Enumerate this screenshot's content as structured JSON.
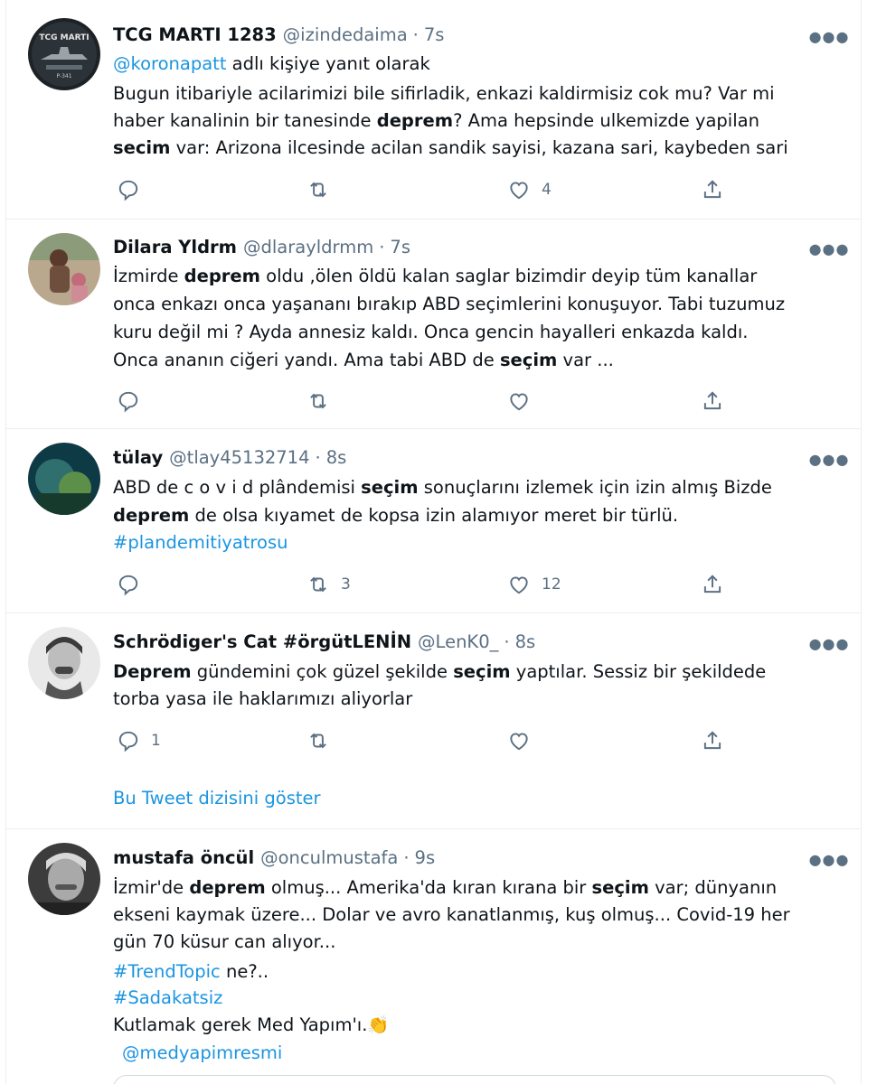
{
  "tweets": [
    {
      "name": "TCG MARTI 1283",
      "handle": "@izindedaima",
      "dot": "·",
      "time": "7s",
      "reply_to_handle": "@koronapatt",
      "reply_to_text": " adlı kişiye yanıt olarak",
      "lines": [
        [
          "Bugun itibariyle acilarimizi bile sifirladik, enkazi kaldirmisiz cok mu? Var mi"
        ],
        [
          "haber kanalinin bir tanesinde ",
          "deprem",
          "? Ama hepsinde ulkemizde yapilan"
        ],
        [
          "secim",
          " var: Arizona ilcesinde acilan sandik sayisi, kazana sari, kaybeden sari"
        ]
      ],
      "reply_count": "",
      "retweet_count": "",
      "like_count": "4",
      "avatar_text": "TCG MARTI"
    },
    {
      "name": "Dilara Yldrm",
      "handle": "@dlarayldrmm",
      "dot": "·",
      "time": "7s",
      "lines": [
        [
          "İzmirde ",
          "deprem",
          " oldu ,ölen öldü kalan saglar bizimdir deyip tüm kanallar"
        ],
        [
          "onca enkazı onca yaşananı bırakıp ABD seçimlerini konuşuyor. Tabi tuzumuz"
        ],
        [
          "kuru değil mi ? Ayda annesiz kaldı. Onca gencin hayalleri enkazda kaldı."
        ],
        [
          "Onca ananın ciğeri yandı. Ama tabi ABD de ",
          "seçim",
          " var ..."
        ]
      ],
      "reply_count": "",
      "retweet_count": "",
      "like_count": ""
    },
    {
      "name": "tülay",
      "handle": "@tlay45132714",
      "dot": "·",
      "time": "8s",
      "lines": [
        [
          "ABD de c o v i d plândemisi ",
          "seçim",
          " sonuçlarını izlemek için izin almış Bizde"
        ],
        [
          "",
          "deprem",
          " de olsa kıyamet de kopsa izin alamıyor meret bir türlü."
        ]
      ],
      "hashtag": "#plandemitiyatrosu",
      "reply_count": "",
      "retweet_count": "3",
      "like_count": "12"
    },
    {
      "name": "Schrödiger's Cat #örgütLENİN",
      "handle": "@LenK0_",
      "dot": "·",
      "time": "8s",
      "lines": [
        [
          "",
          "Deprem",
          " gündemini çok güzel şekilde ",
          "seçim",
          " yaptılar. Sessiz bir şekildede"
        ],
        [
          "torba yasa ile haklarımızı aliyorlar"
        ]
      ],
      "reply_count": "1",
      "retweet_count": "",
      "like_count": "",
      "show_thread": "Bu Tweet dizisini göster"
    },
    {
      "name": "mustafa öncül",
      "handle": "@onculmustafa",
      "dot": "·",
      "time": "9s",
      "lines": [
        [
          "İzmir'de ",
          "deprem",
          " olmuş... Amerika'da kıran kırana bir ",
          "seçim",
          " var; dünyanın"
        ],
        [
          "ekseni kaymak üzere... Dolar ve avro kanatlanmış, kuş olmuş... Covid-19 her"
        ],
        [
          "gün 70 küsur can alıyor..."
        ]
      ],
      "hashtag_line": {
        "tag": "#TrendTopic",
        "rest": " ne?.."
      },
      "hashtag2": "#Sadakatsiz",
      "closing_text": "Kutlamak gerek Med Yapım'ı.",
      "closing_emoji": "👏",
      "mention": "@medyapimresmi"
    }
  ],
  "icons": [
    "reply-icon",
    "retweet-icon",
    "like-icon",
    "share-icon",
    "more-icon"
  ],
  "colors": {
    "link": "#1b95e0",
    "muted": "#5b7083",
    "border": "#ebeef0"
  }
}
